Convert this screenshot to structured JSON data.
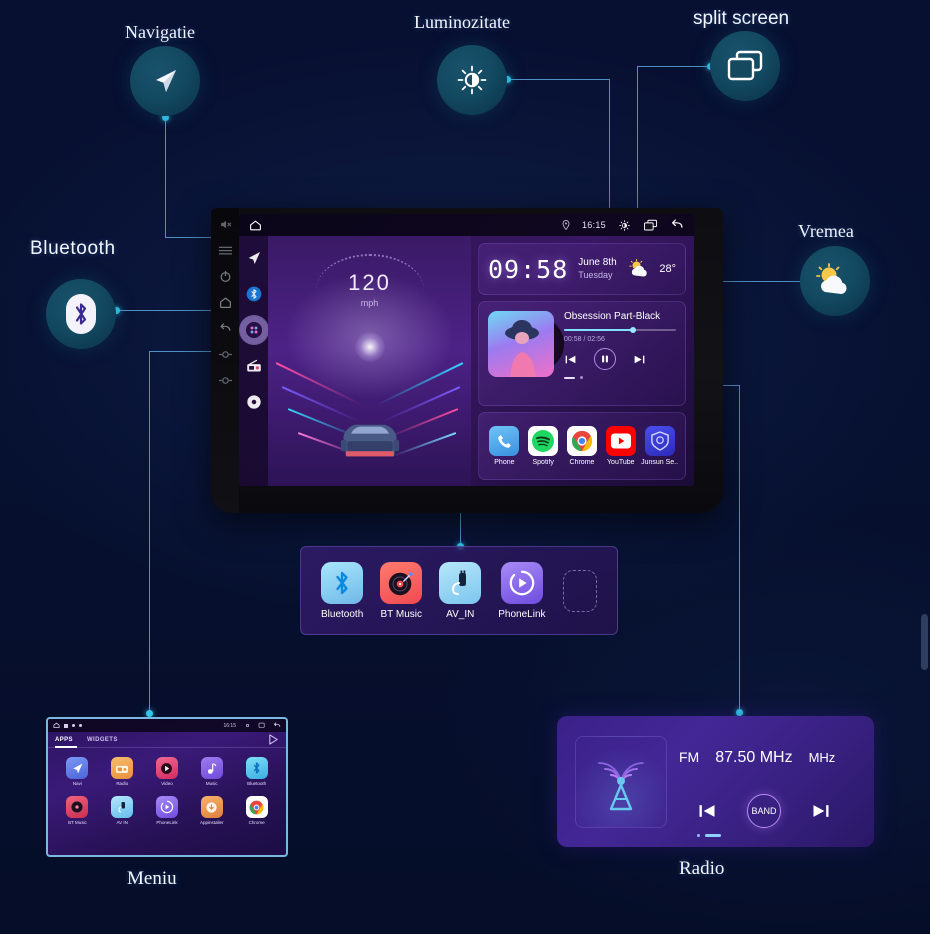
{
  "page": {
    "background_color": "#061030",
    "accent_line_color": "#4f90c4",
    "accent_dot_color": "#2ec7e8"
  },
  "callouts": [
    {
      "id": "navigatie",
      "label": "Navigatie",
      "icon": "navigation-arrow-icon"
    },
    {
      "id": "luminozitate",
      "label": "Luminozitate",
      "icon": "brightness-icon"
    },
    {
      "id": "split",
      "label": "split screen",
      "icon": "split-screen-icon"
    },
    {
      "id": "bluetooth",
      "label": "Bluetooth",
      "icon": "bluetooth-icon"
    },
    {
      "id": "vremea",
      "label": "Vremea",
      "icon": "partly-cloudy-icon"
    },
    {
      "id": "meniu",
      "label": "Meniu",
      "icon": "apps-grid-icon"
    },
    {
      "id": "radio",
      "label": "Radio",
      "icon": "radio-icon"
    }
  ],
  "head_unit": {
    "status_bar": {
      "location_icon": "location-pin-icon",
      "clock": "16:15",
      "brightness_icon": "brightness-icon",
      "split_screen_icon": "split-screen-icon",
      "back_icon": "back-arrow-icon"
    },
    "home_icon": "home-icon",
    "side_rail": [
      {
        "name": "navigation",
        "icon": "navigation-arrow-icon"
      },
      {
        "name": "bluetooth",
        "icon": "bluetooth-icon"
      },
      {
        "name": "apps",
        "icon": "apps-grid-icon",
        "active": true
      },
      {
        "name": "radio",
        "icon": "radio-icon"
      },
      {
        "name": "settings",
        "icon": "settings-gear-icon"
      }
    ],
    "hardware_buttons": [
      "mute-icon",
      "menu-icon",
      "power-icon",
      "home-icon",
      "back-icon",
      "volume-down-icon",
      "volume-up-icon"
    ],
    "dashboard": {
      "speed_value": "120",
      "speed_unit": "mph"
    },
    "clock_card": {
      "time": "09:58",
      "date": "June 8th",
      "weekday": "Tuesday",
      "weather_icon": "partly-cloudy-icon",
      "temperature": "28°"
    },
    "music_card": {
      "track_title": "Obsession Part-Black",
      "elapsed_total": "00:58 / 02:56",
      "progress_percent": 62,
      "prev_icon": "previous-track-icon",
      "play_pause_icon": "pause-icon",
      "next_icon": "next-track-icon"
    },
    "apps": [
      {
        "label": "Phone",
        "icon": "phone-icon",
        "color": "#3fa9f5"
      },
      {
        "label": "Spotify",
        "icon": "spotify-icon",
        "color": "#1ed760"
      },
      {
        "label": "Chrome",
        "icon": "chrome-icon",
        "color": "#ffffff"
      },
      {
        "label": "YouTube",
        "icon": "youtube-icon",
        "color": "#ff0000"
      },
      {
        "label": "Junsun Se..",
        "icon": "junsun-icon",
        "color": "#3b3fe0"
      }
    ]
  },
  "bt_panel": {
    "tiles": [
      {
        "label": "Bluetooth",
        "icon": "bluetooth-icon",
        "color": "#7ed0f7"
      },
      {
        "label": "BT Music",
        "icon": "vinyl-record-icon",
        "color": "#f2585b"
      },
      {
        "label": "AV_IN",
        "icon": "av-cable-icon",
        "color": "#8ed4f5"
      },
      {
        "label": "PhoneLink",
        "icon": "phonelink-icon",
        "color": "#8a6bf0"
      }
    ],
    "empty_slot": "empty-app-slot"
  },
  "menu_shot": {
    "status_clock": "16:15",
    "tabs": [
      {
        "label": "APPS",
        "active": true
      },
      {
        "label": "WIDGETS",
        "active": false
      }
    ],
    "play_store_icon": "play-store-icon",
    "apps": [
      {
        "label": "Navi",
        "icon": "navigation-arrow-icon",
        "color": "#5b7ff0"
      },
      {
        "label": "Radio",
        "icon": "radio-icon",
        "color": "#f0a14a"
      },
      {
        "label": "Video",
        "icon": "video-play-icon",
        "color": "#e0447a"
      },
      {
        "label": "Music",
        "icon": "music-note-icon",
        "color": "#8a62e8"
      },
      {
        "label": "Bluetooth",
        "icon": "bluetooth-icon",
        "color": "#3fc4f0"
      },
      {
        "label": "BT Music",
        "icon": "vinyl-record-icon",
        "color": "#e24b6b"
      },
      {
        "label": "AV IN",
        "icon": "av-cable-icon",
        "color": "#6fc9f5"
      },
      {
        "label": "PhoneLink",
        "icon": "phonelink-icon",
        "color": "#8a6bf0"
      },
      {
        "label": "Appinstaller",
        "icon": "app-installer-icon",
        "color": "#f09a4a"
      },
      {
        "label": "Chrome",
        "icon": "chrome-icon",
        "color": "#ffffff"
      }
    ]
  },
  "radio_widget": {
    "band": "FM",
    "frequency": "87.50 MHz",
    "unit": "MHz",
    "prev_icon": "previous-station-icon",
    "band_button": "BAND",
    "next_icon": "next-station-icon",
    "tower_icon": "radio-tower-icon"
  }
}
